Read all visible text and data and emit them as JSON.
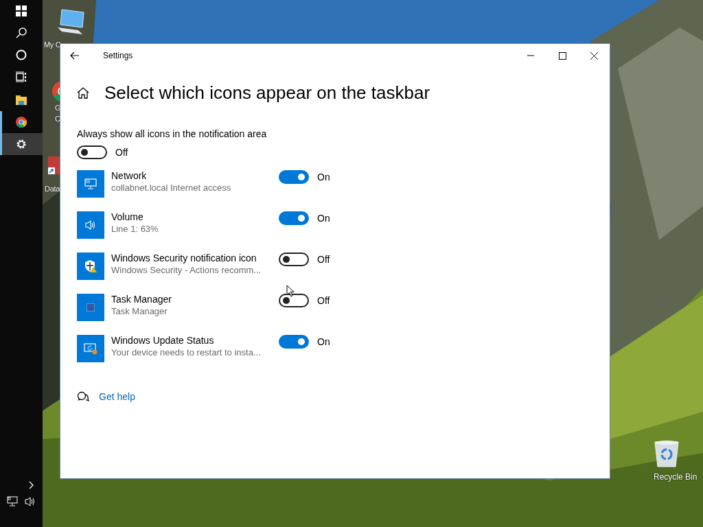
{
  "taskbar": {
    "items": [
      {
        "kind": "start",
        "running": false,
        "selected": false
      },
      {
        "kind": "search",
        "running": false,
        "selected": false
      },
      {
        "kind": "cortana",
        "running": false,
        "selected": false
      },
      {
        "kind": "taskview",
        "running": false,
        "selected": false
      },
      {
        "kind": "explorer",
        "running": false,
        "selected": false
      },
      {
        "kind": "chrome",
        "running": true,
        "selected": false
      },
      {
        "kind": "settings",
        "running": true,
        "selected": true
      }
    ]
  },
  "desktop_icons": [
    {
      "kind": "computer",
      "lines": [
        "My C"
      ]
    },
    {
      "kind": "chrome",
      "lines": [
        "G",
        "C"
      ]
    },
    {
      "kind": "shortcut",
      "lines": [
        "Data"
      ]
    },
    {
      "kind": "recycle",
      "lines": [
        "Recycle Bin"
      ]
    }
  ],
  "window": {
    "title": "Settings",
    "heading": "Select which icons appear on the taskbar",
    "always_show": {
      "label": "Always show all icons in the notification area",
      "on": false,
      "state_text": "Off"
    },
    "rows": [
      {
        "kind": "network",
        "name": "Network",
        "detail": "collabnet.local Internet access",
        "on": true,
        "state_text": "On"
      },
      {
        "kind": "volume",
        "name": "Volume",
        "detail": "Line 1: 63%",
        "on": true,
        "state_text": "On"
      },
      {
        "kind": "security",
        "name": "Windows Security notification icon",
        "detail": "Windows Security - Actions recomm...",
        "on": false,
        "state_text": "Off"
      },
      {
        "kind": "taskmanager",
        "name": "Task Manager",
        "detail": "Task Manager",
        "on": false,
        "state_text": "Off"
      },
      {
        "kind": "update",
        "name": "Windows Update Status",
        "detail": "Your device needs to restart to insta...",
        "on": true,
        "state_text": "On"
      }
    ],
    "help_link": "Get help"
  }
}
